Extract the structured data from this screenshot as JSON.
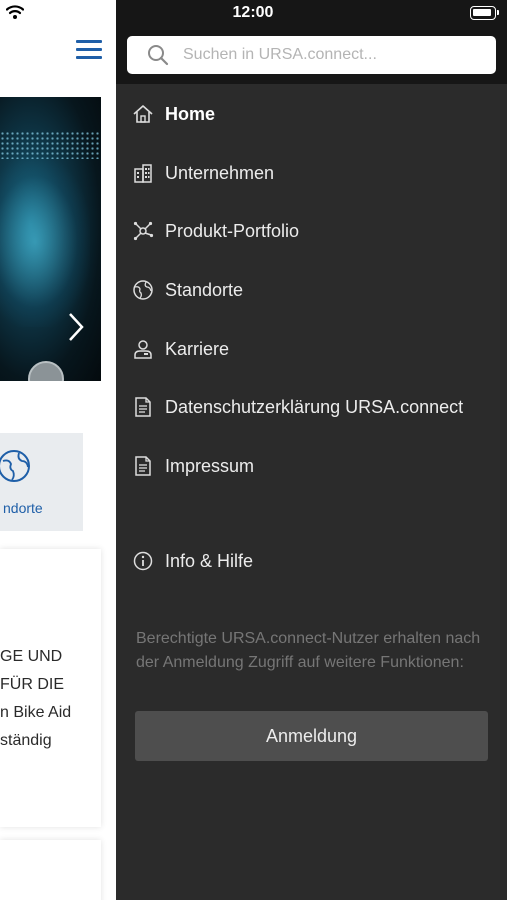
{
  "status_bar": {
    "time": "12:00"
  },
  "search": {
    "placeholder": "Suchen in URSA.connect..."
  },
  "menu": {
    "items": [
      {
        "label": "Home",
        "icon": "home-icon"
      },
      {
        "label": "Unternehmen",
        "icon": "building-icon"
      },
      {
        "label": "Produkt-Portfolio",
        "icon": "network-icon"
      },
      {
        "label": "Standorte",
        "icon": "globe-icon"
      },
      {
        "label": "Karriere",
        "icon": "person-icon"
      },
      {
        "label": "Datenschutzerklärung URSA.connect",
        "icon": "document-icon"
      },
      {
        "label": "Impressum",
        "icon": "document-icon"
      }
    ],
    "info": {
      "label": "Info & Hilfe",
      "icon": "info-icon"
    }
  },
  "login": {
    "text": "Berechtigte URSA.connect-Nutzer erhalten nach der Anmeldung Zugriff auf weitere Funktionen:",
    "button_label": "Anmeldung"
  },
  "background": {
    "tile_label": "ndorte",
    "card_lines": [
      "GE UND",
      " FÜR DIE",
      "n Bike Aid",
      "ständig"
    ]
  },
  "colors": {
    "drawer_bg": "#2b2b2b",
    "drawer_header_bg": "#161616",
    "accent_blue": "#1f5fa8",
    "button_bg": "#4e4e4e"
  }
}
